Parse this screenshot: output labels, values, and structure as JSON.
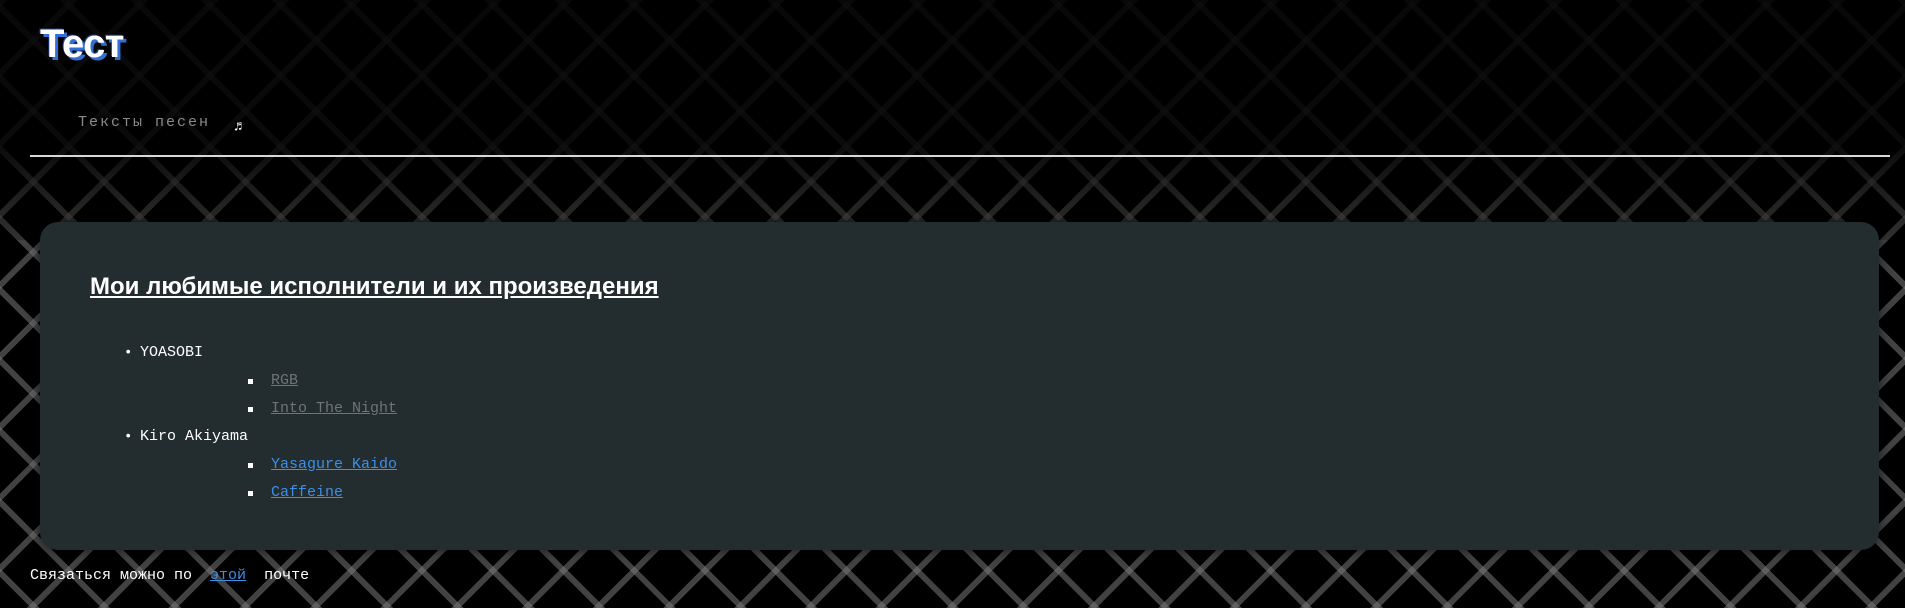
{
  "header": {
    "site_title": "Тест",
    "nav": {
      "lyrics_label": "Тексты песен",
      "icon": "music-note-icon"
    }
  },
  "main": {
    "heading": "Мои любимые исполнители и их произведения",
    "artists": [
      {
        "name": "YOASOBI",
        "songs": [
          {
            "title": "RGB",
            "state": "visited"
          },
          {
            "title": "Into The Night",
            "state": "visited"
          }
        ]
      },
      {
        "name": "Kiro Akiyama",
        "songs": [
          {
            "title": "Yasagure Kaido",
            "state": "unvisited"
          },
          {
            "title": "Caffeine",
            "state": "unvisited"
          }
        ]
      }
    ]
  },
  "footer": {
    "text_before": "Связаться можно по",
    "link_label": "этой",
    "text_after": "почте"
  },
  "colors": {
    "background": "#000000",
    "card": "#232c2f",
    "link": "#3d8fe6",
    "visited_link": "#6f7477",
    "title_shadow": "#2f6fd6"
  }
}
